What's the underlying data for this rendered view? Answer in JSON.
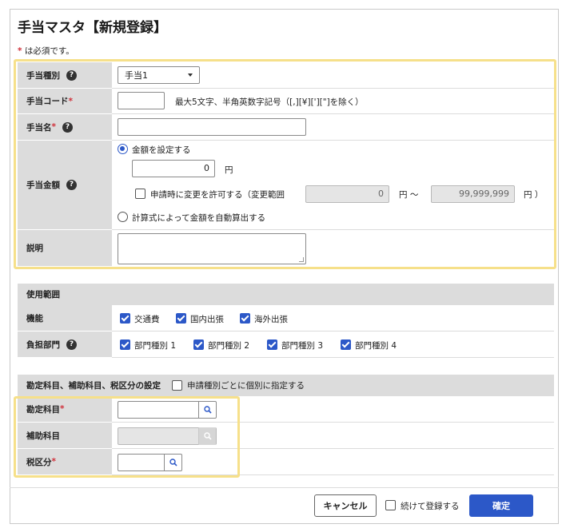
{
  "page": {
    "title": "手当マスタ【新規登録】",
    "required_mark": "*",
    "required_note": " は必須です。"
  },
  "fields": {
    "allowance_type": {
      "label": "手当種別",
      "value": "手当1"
    },
    "allowance_code": {
      "label": "手当コード",
      "value": "",
      "hint": "最大5文字、半角英数字記号（[,][¥]['][\"]を除く）"
    },
    "allowance_name": {
      "label": "手当名",
      "value": ""
    },
    "allowance_amount": {
      "label": "手当金額",
      "option_fixed": "金額を設定する",
      "amount_value": "0",
      "yen": "円",
      "allow_change_label": "申請時に変更を許可する（変更範囲",
      "range_min": "0",
      "range_sep": "円 〜",
      "range_max": "99,999,999",
      "range_end": "円 ）",
      "option_formula": "計算式によって金額を自動算出する"
    },
    "description": {
      "label": "説明",
      "value": ""
    }
  },
  "scope": {
    "header": "使用範囲",
    "functions_label": "機能",
    "functions": [
      "交通費",
      "国内出張",
      "海外出張"
    ],
    "departments_label": "負担部門",
    "departments": [
      "部門種別 1",
      "部門種別 2",
      "部門種別 3",
      "部門種別 4"
    ]
  },
  "accounting": {
    "header": "勘定科目、補助科目、税区分の設定",
    "individual_label": "申請種別ごとに個別に指定する",
    "account_label": "勘定科目",
    "subaccount_label": "補助科目",
    "tax_label": "税区分"
  },
  "footer": {
    "cancel": "キャンセル",
    "continue_label": "続けて登録する",
    "confirm": "確定"
  },
  "colors": {
    "accent": "#2c58c8",
    "highlight": "#f6e08a",
    "label_bg": "#dcdcdc",
    "required": "#d0303a"
  },
  "icons": {
    "help": "question-circle-icon",
    "search": "search-icon",
    "dropdown": "caret-down-icon"
  }
}
